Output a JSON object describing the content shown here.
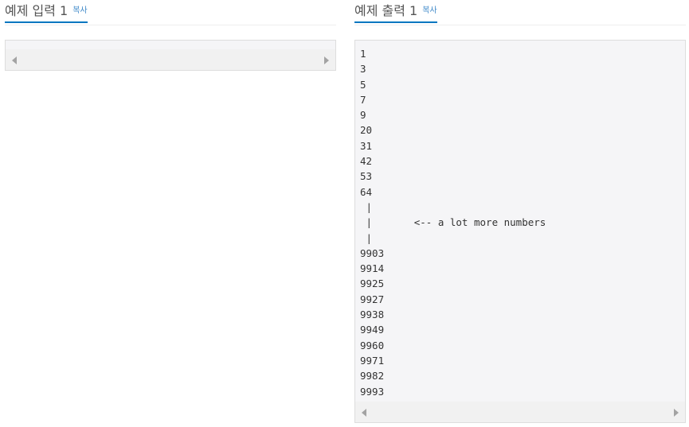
{
  "sample_input": {
    "title": "예제 입력 1",
    "copy_label": "복사"
  },
  "sample_output": {
    "title": "예제 출력 1",
    "copy_label": "복사",
    "lines": [
      "1",
      "3",
      "5",
      "7",
      "9",
      "20",
      "31",
      "42",
      "53",
      "64",
      " |",
      " |       <-- a lot more numbers",
      " |",
      "9903",
      "9914",
      "9925",
      "9927",
      "9938",
      "9949",
      "9960",
      "9971",
      "9982",
      "9993"
    ]
  }
}
